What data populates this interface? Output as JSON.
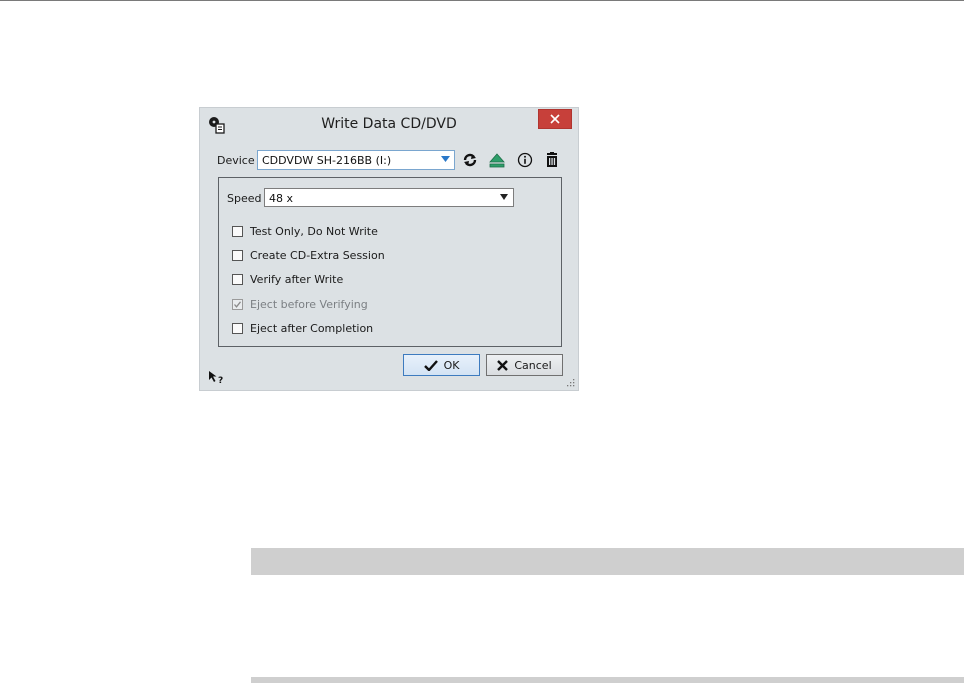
{
  "dialog": {
    "title": "Write Data CD/DVD",
    "close_glyph": "✕",
    "device_label": "Device",
    "device_value": "CDDVDW SH-216BB (I:)",
    "speed_label": "Speed",
    "speed_value": "48 x",
    "options": [
      {
        "label": "Test Only, Do Not Write",
        "checked": false,
        "enabled": true
      },
      {
        "label": "Create CD-Extra Session",
        "checked": false,
        "enabled": true
      },
      {
        "label": "Verify after Write",
        "checked": false,
        "enabled": true
      },
      {
        "label": "Eject before Verifying",
        "checked": true,
        "enabled": false
      },
      {
        "label": "Eject after Completion",
        "checked": false,
        "enabled": true
      }
    ],
    "ok_label": "OK",
    "cancel_label": "Cancel",
    "icons": [
      "app-icon",
      "close-icon",
      "refresh-icon",
      "eject-icon",
      "info-icon",
      "erase-icon",
      "ok-check-icon",
      "cancel-x-icon",
      "help-pointer-icon",
      "resize-grip-icon"
    ],
    "colors": {
      "close": "#c7403a",
      "eject": "#2e9e6a",
      "ok_border": "#3d7bbf",
      "dialog_bg": "#dce1e4"
    }
  }
}
